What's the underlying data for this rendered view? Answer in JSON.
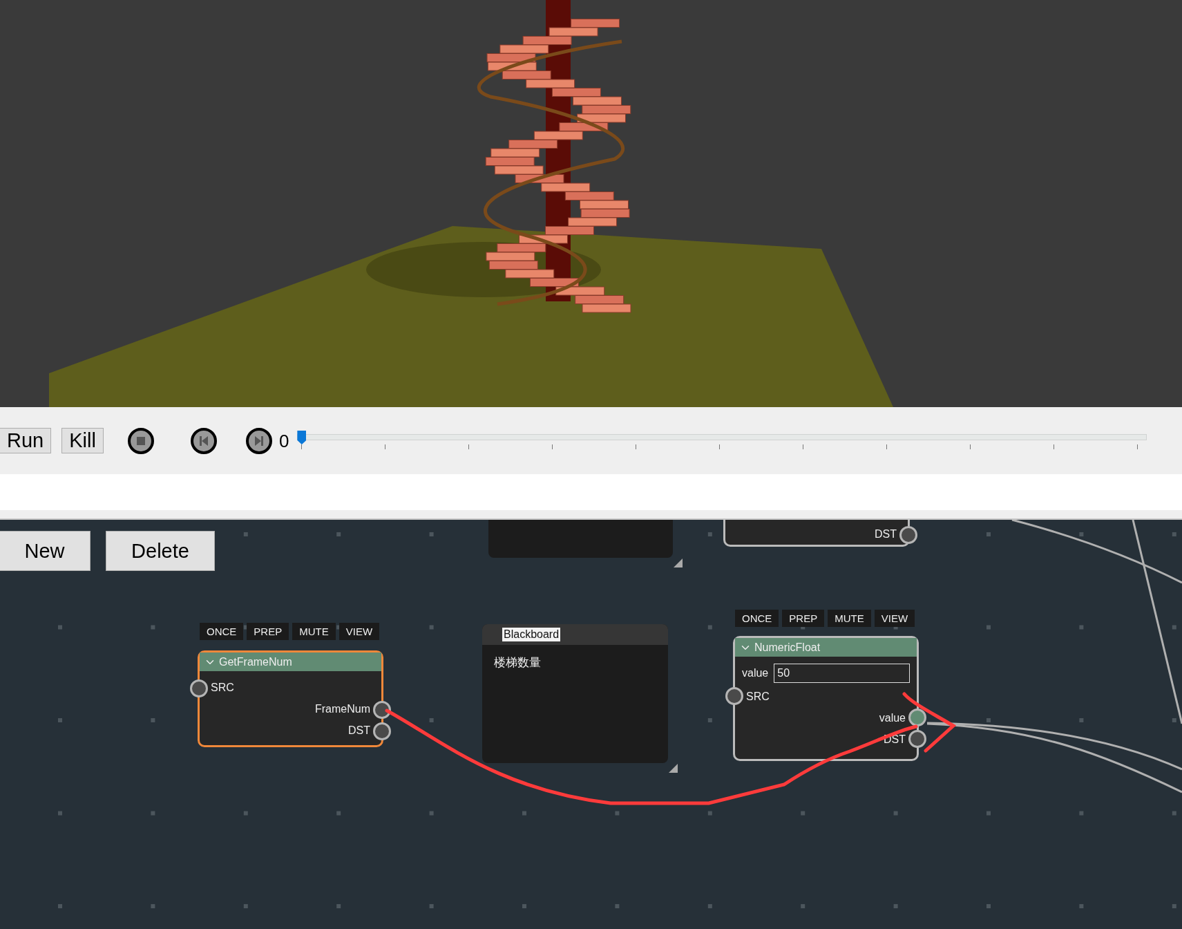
{
  "toolbar": {
    "buttons": [
      "Run",
      "Kill"
    ],
    "frame": "0",
    "timeline": {
      "level": 0
    }
  },
  "editor": {
    "buttons": [
      "New",
      "Delete"
    ],
    "nodes": [
      {
        "kind": "block"
      },
      {
        "kind": "node",
        "selected": false,
        "outputs": [
          {
            "label": "DST",
            "connected": false
          }
        ]
      },
      {
        "kind": "node",
        "selected": true,
        "flags": [
          "ONCE",
          "PREP",
          "MUTE",
          "VIEW"
        ],
        "title": "GetFrameNum",
        "inputs": [
          {
            "label": "SRC",
            "connected": false
          }
        ],
        "outputs": [
          {
            "label": "FrameNum",
            "connected": false
          },
          {
            "label": "DST",
            "connected": false
          }
        ]
      },
      {
        "kind": "blackboard",
        "title": "Blackboard",
        "text": "楼梯数量"
      },
      {
        "kind": "node",
        "selected": false,
        "flags": [
          "ONCE",
          "PREP",
          "MUTE",
          "VIEW"
        ],
        "title": "NumericFloat",
        "field": {
          "label": "value",
          "value": "50"
        },
        "inputs": [
          {
            "label": "SRC",
            "connected": false
          }
        ],
        "outputs": [
          {
            "label": "value",
            "connected": true
          },
          {
            "label": "DST",
            "connected": false
          }
        ]
      }
    ]
  }
}
